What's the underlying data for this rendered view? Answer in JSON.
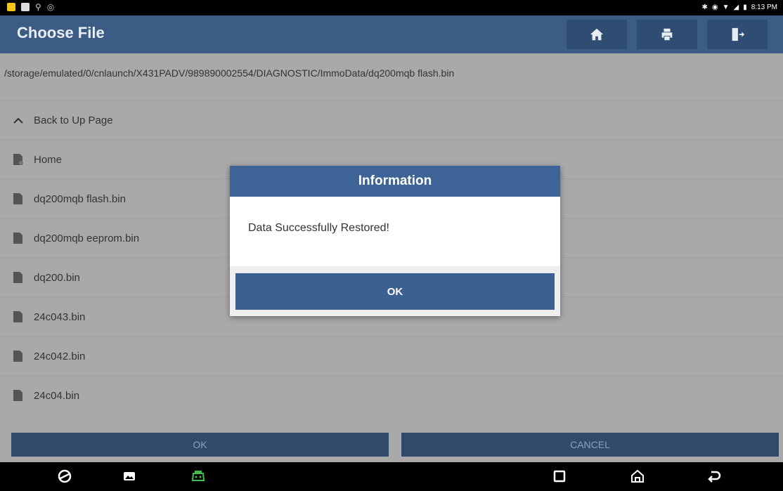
{
  "status_bar": {
    "time": "8:13 PM",
    "right_icons": [
      "bluetooth-icon",
      "alarm-icon",
      "wifi-icon",
      "signal-icon",
      "battery-icon"
    ],
    "left_icons": [
      "notification-icon",
      "gallery-icon",
      "usb-icon",
      "location-icon"
    ]
  },
  "header": {
    "title": "Choose File",
    "buttons": [
      "home-icon",
      "print-icon",
      "exit-icon"
    ]
  },
  "path": "/storage/emulated/0/cnlaunch/X431PADV/989890002554/DIAGNOSTIC/ImmoData/dq200mqb flash.bin",
  "file_list": {
    "back_label": "Back to Up Page",
    "items": [
      "Home",
      "dq200mqb flash.bin",
      "dq200mqb eeprom.bin",
      "dq200.bin",
      "24c043.bin",
      "24c042.bin",
      "24c04.bin"
    ]
  },
  "footer": {
    "ok_label": "OK",
    "cancel_label": "CANCEL"
  },
  "dialog": {
    "title": "Information",
    "message": "Data Successfully Restored!",
    "ok_label": "OK"
  },
  "nav_bar": {
    "icons": [
      "browser-icon",
      "gallery-icon",
      "diagnostic-app-icon",
      "recents-icon",
      "home-icon",
      "back-icon"
    ],
    "accent": "#3fbf4a"
  },
  "colors": {
    "header": "#3c5c85",
    "dialog_title": "#3e6497",
    "dim_background": "#a9a9a9"
  }
}
